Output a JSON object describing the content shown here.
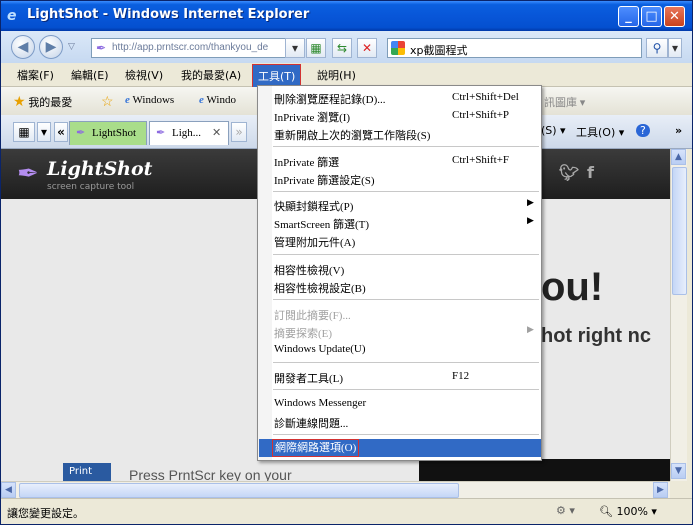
{
  "window": {
    "title": "LightShot - Windows Internet Explorer",
    "minimize": "_",
    "maximize": "□",
    "close": "✕"
  },
  "address": {
    "url": "http://app.prntscr.com/thankyou_de",
    "search_value": "xp截圖程式"
  },
  "menubar": [
    {
      "label": "檔案(F)"
    },
    {
      "label": "編輯(E)"
    },
    {
      "label": "檢視(V)"
    },
    {
      "label": "我的最愛(A)"
    },
    {
      "label": "工具(T)"
    },
    {
      "label": "說明(H)"
    }
  ],
  "favorites": {
    "label": "我的最愛",
    "items": [
      {
        "label": "Windows"
      },
      {
        "label": "Windo"
      }
    ],
    "right_text": "訊圖庫 ▾"
  },
  "tabs": [
    {
      "label": "LightShot"
    },
    {
      "label": "Ligh..."
    }
  ],
  "tab_tools": {
    "safety": "(S) ▾",
    "tools": "工具(O) ▾",
    "help": "?"
  },
  "page": {
    "logo": "LightShot",
    "tagline": "screen capture tool",
    "thanks_partial": "ou!",
    "sub_partial": "hot right nc",
    "print_button": "Print",
    "press_text": "Press PrntScr key on your"
  },
  "tools_menu": {
    "items": [
      {
        "label": "刪除瀏覽歷程記錄(D)...",
        "shortcut": "Ctrl+Shift+Del"
      },
      {
        "label": "InPrivate 瀏覽(I)",
        "shortcut": "Ctrl+Shift+P"
      },
      {
        "label": "重新開啟上次的瀏覽工作階段(S)",
        "shortcut": ""
      },
      {
        "label": "InPrivate 篩選",
        "shortcut": "Ctrl+Shift+F"
      },
      {
        "label": "InPrivate 篩選設定(S)",
        "shortcut": ""
      },
      {
        "label": "快顯封鎖程式(P)",
        "shortcut": ""
      },
      {
        "label": "SmartScreen 篩選(T)",
        "shortcut": ""
      },
      {
        "label": "管理附加元件(A)",
        "shortcut": ""
      },
      {
        "label": "相容性檢視(V)",
        "shortcut": ""
      },
      {
        "label": "相容性檢視設定(B)",
        "shortcut": ""
      },
      {
        "label": "訂閱此摘要(F)...",
        "shortcut": ""
      },
      {
        "label": "摘要探索(E)",
        "shortcut": ""
      },
      {
        "label": "Windows Update(U)",
        "shortcut": ""
      },
      {
        "label": "開發者工具(L)",
        "shortcut": "F12"
      },
      {
        "label": "Windows Messenger",
        "shortcut": ""
      },
      {
        "label": "診斷連線問題...",
        "shortcut": ""
      },
      {
        "label": "網際網路選項(O)",
        "shortcut": ""
      }
    ]
  },
  "status": {
    "text": "讓您變更設定。",
    "zoom": "100%"
  }
}
